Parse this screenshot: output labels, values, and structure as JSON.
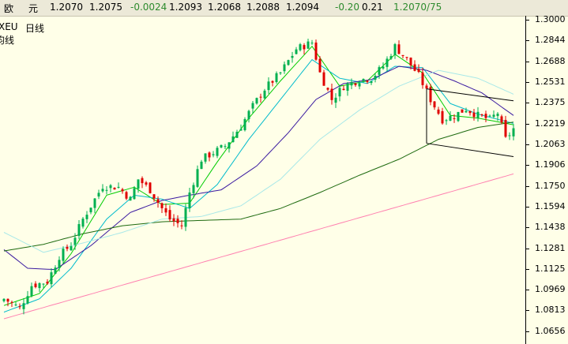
{
  "quote": {
    "name_a": "欧",
    "name_b": "元",
    "open": "1.2070",
    "ask": "1.2075",
    "change": "-0.0024",
    "high1": "1.2093",
    "low1": "1.2068",
    "high2": "1.2088",
    "close": "1.2094",
    "change_pips": "-0.20",
    "change_pct": "0.21",
    "bid_ask": "1.2070/75"
  },
  "labels": {
    "symbol": "XEU",
    "period": "日线",
    "indicator": "均线"
  },
  "colors": {
    "up_candle": "#00b050",
    "down_candle": "#e00000",
    "ma_fast": "#00cc00",
    "ma_cyan": "#00bbcc",
    "ma_purple": "#3a1aa0",
    "ma_green": "#1e6a10",
    "ma_pink": "#ff80b0",
    "ma_lightcyan": "#a8e8e8",
    "channel": "#000000",
    "background": "#ffffe8"
  },
  "chart_data": {
    "type": "candlestick",
    "yticks": [
      "1.3000",
      "1.2844",
      "1.2688",
      "1.2531",
      "1.2375",
      "1.2219",
      "1.2063",
      "1.1906",
      "1.1750",
      "1.1594",
      "1.1438",
      "1.1281",
      "1.1125",
      "1.0969",
      "1.0813",
      "1.0656"
    ],
    "ylim": [
      1.056,
      1.303
    ],
    "num_bars": 130,
    "anchors": [
      [
        0,
        1.09
      ],
      [
        4,
        1.083
      ],
      [
        7,
        1.1
      ],
      [
        11,
        1.103
      ],
      [
        14,
        1.122
      ],
      [
        17,
        1.131
      ],
      [
        20,
        1.15
      ],
      [
        25,
        1.175
      ],
      [
        29,
        1.174
      ],
      [
        32,
        1.165
      ],
      [
        34,
        1.18
      ],
      [
        37,
        1.172
      ],
      [
        40,
        1.158
      ],
      [
        42,
        1.15
      ],
      [
        45,
        1.145
      ],
      [
        47,
        1.17
      ],
      [
        50,
        1.195
      ],
      [
        53,
        1.2
      ],
      [
        56,
        1.205
      ],
      [
        60,
        1.22
      ],
      [
        63,
        1.235
      ],
      [
        66,
        1.248
      ],
      [
        70,
        1.26
      ],
      [
        74,
        1.278
      ],
      [
        78,
        1.283
      ],
      [
        80,
        1.26
      ],
      [
        83,
        1.24
      ],
      [
        86,
        1.25
      ],
      [
        90,
        1.255
      ],
      [
        93,
        1.256
      ],
      [
        96,
        1.265
      ],
      [
        99,
        1.28
      ],
      [
        102,
        1.27
      ],
      [
        105,
        1.258
      ],
      [
        108,
        1.24
      ],
      [
        111,
        1.225
      ],
      [
        114,
        1.228
      ],
      [
        117,
        1.233
      ],
      [
        120,
        1.228
      ],
      [
        123,
        1.225
      ],
      [
        125,
        1.23
      ],
      [
        127,
        1.21
      ],
      [
        129,
        1.218
      ]
    ],
    "moving_averages": [
      {
        "key": "ma_fast",
        "anchors": [
          [
            0,
            1.085
          ],
          [
            9,
            1.094
          ],
          [
            17,
            1.124
          ],
          [
            26,
            1.168
          ],
          [
            33,
            1.174
          ],
          [
            40,
            1.161
          ],
          [
            47,
            1.162
          ],
          [
            54,
            1.193
          ],
          [
            62,
            1.226
          ],
          [
            70,
            1.254
          ],
          [
            78,
            1.28
          ],
          [
            85,
            1.25
          ],
          [
            92,
            1.254
          ],
          [
            99,
            1.274
          ],
          [
            106,
            1.26
          ],
          [
            113,
            1.228
          ],
          [
            120,
            1.226
          ],
          [
            129,
            1.221
          ]
        ]
      },
      {
        "key": "ma_cyan",
        "anchors": [
          [
            0,
            1.08
          ],
          [
            9,
            1.09
          ],
          [
            17,
            1.113
          ],
          [
            26,
            1.15
          ],
          [
            33,
            1.168
          ],
          [
            40,
            1.165
          ],
          [
            47,
            1.158
          ],
          [
            54,
            1.176
          ],
          [
            62,
            1.21
          ],
          [
            70,
            1.24
          ],
          [
            78,
            1.27
          ],
          [
            85,
            1.256
          ],
          [
            92,
            1.252
          ],
          [
            99,
            1.265
          ],
          [
            106,
            1.264
          ],
          [
            113,
            1.237
          ],
          [
            120,
            1.229
          ],
          [
            129,
            1.222
          ]
        ]
      },
      {
        "key": "ma_purple",
        "anchors": [
          [
            0,
            1.127
          ],
          [
            6,
            1.113
          ],
          [
            13,
            1.112
          ],
          [
            22,
            1.13
          ],
          [
            32,
            1.155
          ],
          [
            40,
            1.164
          ],
          [
            47,
            1.168
          ],
          [
            55,
            1.172
          ],
          [
            64,
            1.19
          ],
          [
            72,
            1.215
          ],
          [
            79,
            1.24
          ],
          [
            86,
            1.252
          ],
          [
            93,
            1.255
          ],
          [
            100,
            1.265
          ],
          [
            107,
            1.262
          ],
          [
            114,
            1.254
          ],
          [
            121,
            1.245
          ],
          [
            129,
            1.228
          ]
        ]
      },
      {
        "key": "ma_green",
        "anchors": [
          [
            0,
            1.126
          ],
          [
            10,
            1.131
          ],
          [
            20,
            1.139
          ],
          [
            30,
            1.145
          ],
          [
            40,
            1.148
          ],
          [
            50,
            1.149
          ],
          [
            60,
            1.15
          ],
          [
            70,
            1.158
          ],
          [
            80,
            1.17
          ],
          [
            90,
            1.183
          ],
          [
            100,
            1.195
          ],
          [
            110,
            1.21
          ],
          [
            120,
            1.219
          ],
          [
            129,
            1.223
          ]
        ]
      },
      {
        "key": "ma_lightcyan",
        "anchors": [
          [
            0,
            1.14
          ],
          [
            10,
            1.125
          ],
          [
            20,
            1.132
          ],
          [
            30,
            1.14
          ],
          [
            40,
            1.15
          ],
          [
            50,
            1.152
          ],
          [
            60,
            1.16
          ],
          [
            70,
            1.18
          ],
          [
            80,
            1.21
          ],
          [
            90,
            1.232
          ],
          [
            100,
            1.25
          ],
          [
            110,
            1.262
          ],
          [
            120,
            1.256
          ],
          [
            129,
            1.244
          ]
        ]
      },
      {
        "key": "ma_pink",
        "anchors": [
          [
            0,
            1.075
          ],
          [
            129,
            1.184
          ]
        ]
      }
    ],
    "channel_lines": [
      {
        "from": [
          107,
          1.248
        ],
        "to": [
          129,
          1.239
        ]
      },
      {
        "from": [
          107,
          1.207
        ],
        "to": [
          129,
          1.197
        ]
      }
    ]
  }
}
